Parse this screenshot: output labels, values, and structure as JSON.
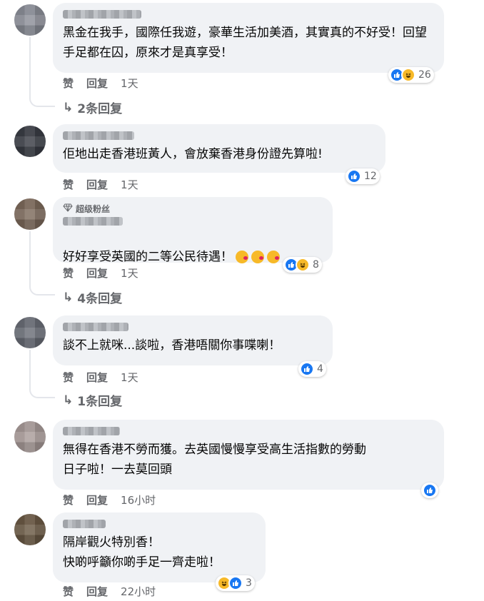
{
  "colors": {
    "like": "#1877f2",
    "haha": "#f7b928",
    "bubble": "#f0f2f5",
    "meta": "#65676b"
  },
  "action_labels": {
    "like": "赞",
    "reply": "回复"
  },
  "comments": [
    {
      "text": "黑金在我手，國際任我遊，豪華生活加美酒，其實真的不好受！回望手足都在囚，原來才是真享受！",
      "reaction_count": "26",
      "reactions": [
        "like",
        "haha"
      ],
      "time": "1天",
      "replies_label": "2条回复"
    },
    {
      "text": "佢地出走香港班黃人，會放棄香港身份證先算啦!",
      "reaction_count": "12",
      "reactions": [
        "like"
      ],
      "time": "1天",
      "replies_label": ""
    },
    {
      "badge": "超级粉丝",
      "text": "好好享受英國的二等公民待遇！",
      "text_emojis": [
        "kissing-heart",
        "kissing-heart",
        "kissing-heart"
      ],
      "reaction_count": "8",
      "reactions": [
        "like",
        "haha"
      ],
      "time": "1天",
      "replies_label": "4条回复"
    },
    {
      "text": "談不上就咪...談啦，香港唔關你事喋喇！",
      "reaction_count": "4",
      "reactions": [
        "like"
      ],
      "time": "1天",
      "replies_label": "1条回复"
    },
    {
      "text": "無得在香港不勞而獲。去英國慢慢享受高生活指數的勞動\n日子啦！一去莫回頭",
      "reaction_count": "",
      "reactions": [
        "like"
      ],
      "time": "16小时",
      "replies_label": ""
    },
    {
      "text": "隔岸觀火特別香！\n快啲呼籲你啲手足一齊走啦！",
      "reaction_count": "3",
      "reactions": [
        "haha",
        "like"
      ],
      "time": "22小时",
      "replies_label": ""
    }
  ]
}
